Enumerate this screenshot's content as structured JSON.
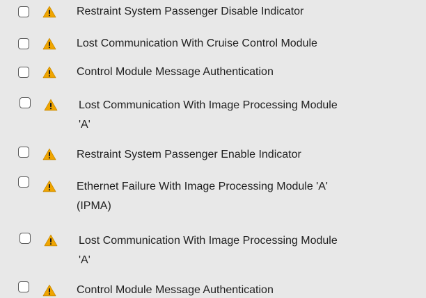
{
  "dtc_list": {
    "items": [
      {
        "checked": false,
        "severity_icon": "warning-triangle-icon",
        "line1": "Restraint System Passenger Disable Indicator",
        "line2": ""
      },
      {
        "checked": false,
        "severity_icon": "warning-triangle-icon",
        "line1": "Lost Communication With Cruise Control Module",
        "line2": ""
      },
      {
        "checked": false,
        "severity_icon": "warning-triangle-icon",
        "line1": "Control Module Message Authentication",
        "line2": ""
      },
      {
        "checked": false,
        "severity_icon": "warning-triangle-icon",
        "line1": "Lost Communication With Image Processing Module",
        "line2": "'A'"
      },
      {
        "checked": false,
        "severity_icon": "warning-triangle-icon",
        "line1": "Restraint System Passenger Enable Indicator",
        "line2": ""
      },
      {
        "checked": false,
        "severity_icon": "warning-triangle-icon",
        "line1": "Ethernet Failure With Image Processing Module 'A'",
        "line2": "(IPMA)"
      },
      {
        "checked": false,
        "severity_icon": "warning-triangle-icon",
        "line1": "Lost Communication With Image Processing Module",
        "line2": "'A'"
      },
      {
        "checked": false,
        "severity_icon": "warning-triangle-icon",
        "line1": "Control Module Message Authentication",
        "line2": ""
      }
    ]
  },
  "colors": {
    "background": "#e8e8e8",
    "warning_fill": "#f0a500",
    "warning_mark": "#1a1a1a",
    "checkbox_border": "#5a5a5a"
  }
}
